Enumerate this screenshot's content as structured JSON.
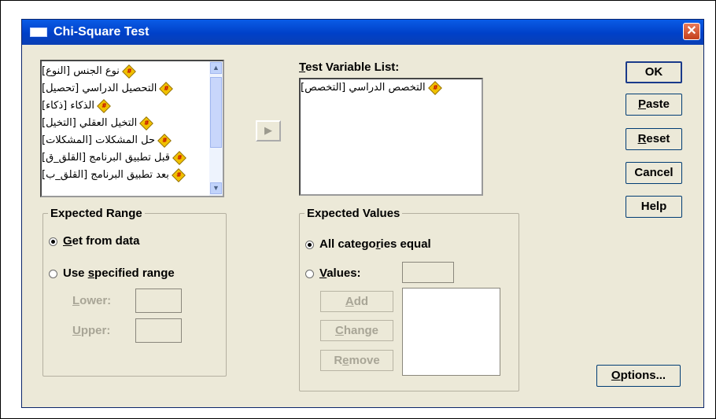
{
  "window": {
    "title": "Chi-Square Test",
    "close_glyph": "✕"
  },
  "variables": {
    "items": [
      {
        "label": "نوع الجنس [النوع]"
      },
      {
        "label": "التحصيل الدراسي [تحصيل]"
      },
      {
        "label": "الذكاء [ذكاء]"
      },
      {
        "label": "التخيل العقلي [التخيل]"
      },
      {
        "label": "حل المشكلات [المشكلات]"
      },
      {
        "label": "قبل تطبيق البرنامج [القلق_ق]"
      },
      {
        "label": "بعد تطبيق البرنامج [القلق_ب]"
      }
    ],
    "scroll_up": "▲",
    "scroll_down": "▼",
    "icon_name": "scale-variable-icon",
    "icon_glyph": "#"
  },
  "move_button": {
    "glyph": "▶"
  },
  "test_variable_list": {
    "label_underlined": "T",
    "label_rest": "est Variable List:",
    "items": [
      {
        "label": "التخصص الدراسي [التخصص]"
      }
    ]
  },
  "buttons": {
    "ok": "OK",
    "paste_u": "P",
    "paste_rest": "aste",
    "reset_u": "R",
    "reset_rest": "eset",
    "cancel": "Cancel",
    "help": "Help",
    "options_u": "O",
    "options_rest": "ptions..."
  },
  "expected_range": {
    "legend": "Expected Range",
    "get_from_data_u": "G",
    "get_from_data_rest": "et from data",
    "use_specified_pre": "Use ",
    "use_specified_u": "s",
    "use_specified_rest": "pecified range",
    "lower_u": "L",
    "lower_rest": "ower:",
    "upper_u": "U",
    "upper_rest": "pper:",
    "selected": "get_from_data"
  },
  "expected_values": {
    "legend": "Expected Values",
    "all_equal_pre": "All catego",
    "all_equal_u": "r",
    "all_equal_rest": "ies equal",
    "values_u": "V",
    "values_rest": "alues:",
    "add_u": "A",
    "add_rest": "dd",
    "change_u": "C",
    "change_rest": "hange",
    "remove_pre": "R",
    "remove_u": "e",
    "remove_rest": "move",
    "selected": "all_categories_equal"
  }
}
